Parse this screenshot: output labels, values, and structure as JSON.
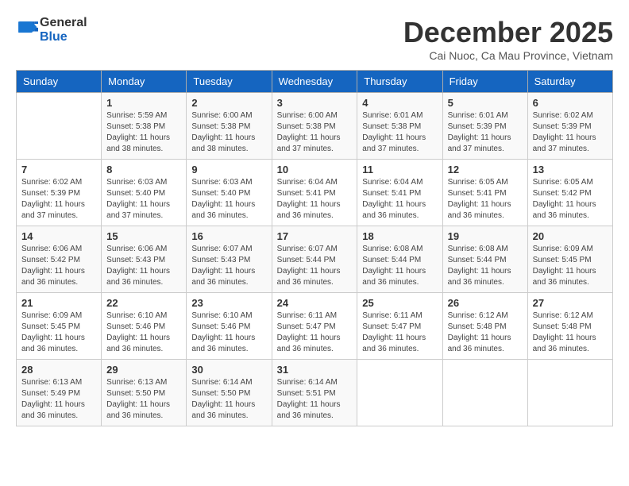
{
  "header": {
    "logo_general": "General",
    "logo_blue": "Blue",
    "month_title": "December 2025",
    "location": "Cai Nuoc, Ca Mau Province, Vietnam"
  },
  "days_of_week": [
    "Sunday",
    "Monday",
    "Tuesday",
    "Wednesday",
    "Thursday",
    "Friday",
    "Saturday"
  ],
  "weeks": [
    [
      {
        "day": "",
        "sunrise": "",
        "sunset": "",
        "daylight": ""
      },
      {
        "day": "1",
        "sunrise": "Sunrise: 5:59 AM",
        "sunset": "Sunset: 5:38 PM",
        "daylight": "Daylight: 11 hours and 38 minutes."
      },
      {
        "day": "2",
        "sunrise": "Sunrise: 6:00 AM",
        "sunset": "Sunset: 5:38 PM",
        "daylight": "Daylight: 11 hours and 38 minutes."
      },
      {
        "day": "3",
        "sunrise": "Sunrise: 6:00 AM",
        "sunset": "Sunset: 5:38 PM",
        "daylight": "Daylight: 11 hours and 37 minutes."
      },
      {
        "day": "4",
        "sunrise": "Sunrise: 6:01 AM",
        "sunset": "Sunset: 5:38 PM",
        "daylight": "Daylight: 11 hours and 37 minutes."
      },
      {
        "day": "5",
        "sunrise": "Sunrise: 6:01 AM",
        "sunset": "Sunset: 5:39 PM",
        "daylight": "Daylight: 11 hours and 37 minutes."
      },
      {
        "day": "6",
        "sunrise": "Sunrise: 6:02 AM",
        "sunset": "Sunset: 5:39 PM",
        "daylight": "Daylight: 11 hours and 37 minutes."
      }
    ],
    [
      {
        "day": "7",
        "sunrise": "Sunrise: 6:02 AM",
        "sunset": "Sunset: 5:39 PM",
        "daylight": "Daylight: 11 hours and 37 minutes."
      },
      {
        "day": "8",
        "sunrise": "Sunrise: 6:03 AM",
        "sunset": "Sunset: 5:40 PM",
        "daylight": "Daylight: 11 hours and 37 minutes."
      },
      {
        "day": "9",
        "sunrise": "Sunrise: 6:03 AM",
        "sunset": "Sunset: 5:40 PM",
        "daylight": "Daylight: 11 hours and 36 minutes."
      },
      {
        "day": "10",
        "sunrise": "Sunrise: 6:04 AM",
        "sunset": "Sunset: 5:41 PM",
        "daylight": "Daylight: 11 hours and 36 minutes."
      },
      {
        "day": "11",
        "sunrise": "Sunrise: 6:04 AM",
        "sunset": "Sunset: 5:41 PM",
        "daylight": "Daylight: 11 hours and 36 minutes."
      },
      {
        "day": "12",
        "sunrise": "Sunrise: 6:05 AM",
        "sunset": "Sunset: 5:41 PM",
        "daylight": "Daylight: 11 hours and 36 minutes."
      },
      {
        "day": "13",
        "sunrise": "Sunrise: 6:05 AM",
        "sunset": "Sunset: 5:42 PM",
        "daylight": "Daylight: 11 hours and 36 minutes."
      }
    ],
    [
      {
        "day": "14",
        "sunrise": "Sunrise: 6:06 AM",
        "sunset": "Sunset: 5:42 PM",
        "daylight": "Daylight: 11 hours and 36 minutes."
      },
      {
        "day": "15",
        "sunrise": "Sunrise: 6:06 AM",
        "sunset": "Sunset: 5:43 PM",
        "daylight": "Daylight: 11 hours and 36 minutes."
      },
      {
        "day": "16",
        "sunrise": "Sunrise: 6:07 AM",
        "sunset": "Sunset: 5:43 PM",
        "daylight": "Daylight: 11 hours and 36 minutes."
      },
      {
        "day": "17",
        "sunrise": "Sunrise: 6:07 AM",
        "sunset": "Sunset: 5:44 PM",
        "daylight": "Daylight: 11 hours and 36 minutes."
      },
      {
        "day": "18",
        "sunrise": "Sunrise: 6:08 AM",
        "sunset": "Sunset: 5:44 PM",
        "daylight": "Daylight: 11 hours and 36 minutes."
      },
      {
        "day": "19",
        "sunrise": "Sunrise: 6:08 AM",
        "sunset": "Sunset: 5:44 PM",
        "daylight": "Daylight: 11 hours and 36 minutes."
      },
      {
        "day": "20",
        "sunrise": "Sunrise: 6:09 AM",
        "sunset": "Sunset: 5:45 PM",
        "daylight": "Daylight: 11 hours and 36 minutes."
      }
    ],
    [
      {
        "day": "21",
        "sunrise": "Sunrise: 6:09 AM",
        "sunset": "Sunset: 5:45 PM",
        "daylight": "Daylight: 11 hours and 36 minutes."
      },
      {
        "day": "22",
        "sunrise": "Sunrise: 6:10 AM",
        "sunset": "Sunset: 5:46 PM",
        "daylight": "Daylight: 11 hours and 36 minutes."
      },
      {
        "day": "23",
        "sunrise": "Sunrise: 6:10 AM",
        "sunset": "Sunset: 5:46 PM",
        "daylight": "Daylight: 11 hours and 36 minutes."
      },
      {
        "day": "24",
        "sunrise": "Sunrise: 6:11 AM",
        "sunset": "Sunset: 5:47 PM",
        "daylight": "Daylight: 11 hours and 36 minutes."
      },
      {
        "day": "25",
        "sunrise": "Sunrise: 6:11 AM",
        "sunset": "Sunset: 5:47 PM",
        "daylight": "Daylight: 11 hours and 36 minutes."
      },
      {
        "day": "26",
        "sunrise": "Sunrise: 6:12 AM",
        "sunset": "Sunset: 5:48 PM",
        "daylight": "Daylight: 11 hours and 36 minutes."
      },
      {
        "day": "27",
        "sunrise": "Sunrise: 6:12 AM",
        "sunset": "Sunset: 5:48 PM",
        "daylight": "Daylight: 11 hours and 36 minutes."
      }
    ],
    [
      {
        "day": "28",
        "sunrise": "Sunrise: 6:13 AM",
        "sunset": "Sunset: 5:49 PM",
        "daylight": "Daylight: 11 hours and 36 minutes."
      },
      {
        "day": "29",
        "sunrise": "Sunrise: 6:13 AM",
        "sunset": "Sunset: 5:50 PM",
        "daylight": "Daylight: 11 hours and 36 minutes."
      },
      {
        "day": "30",
        "sunrise": "Sunrise: 6:14 AM",
        "sunset": "Sunset: 5:50 PM",
        "daylight": "Daylight: 11 hours and 36 minutes."
      },
      {
        "day": "31",
        "sunrise": "Sunrise: 6:14 AM",
        "sunset": "Sunset: 5:51 PM",
        "daylight": "Daylight: 11 hours and 36 minutes."
      },
      {
        "day": "",
        "sunrise": "",
        "sunset": "",
        "daylight": ""
      },
      {
        "day": "",
        "sunrise": "",
        "sunset": "",
        "daylight": ""
      },
      {
        "day": "",
        "sunrise": "",
        "sunset": "",
        "daylight": ""
      }
    ]
  ]
}
